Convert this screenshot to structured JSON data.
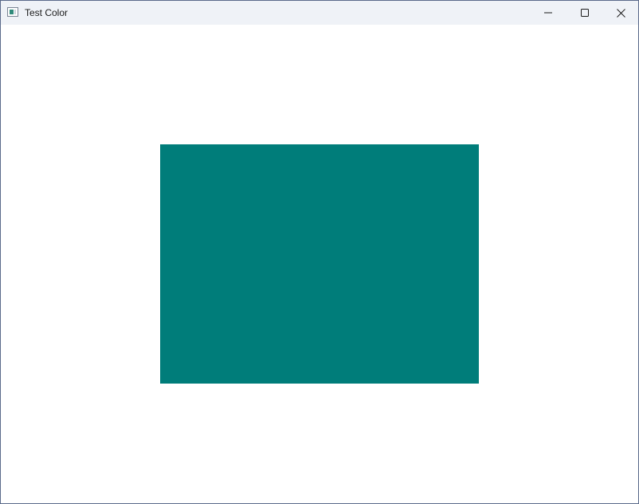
{
  "window": {
    "title": "Test Color",
    "icon": "app-window-icon"
  },
  "titlebar_controls": {
    "minimize_icon": "minimize-icon",
    "maximize_icon": "maximize-icon",
    "close_icon": "close-icon"
  },
  "content": {
    "rect_color": "#007d7a",
    "background_color": "#ffffff"
  }
}
